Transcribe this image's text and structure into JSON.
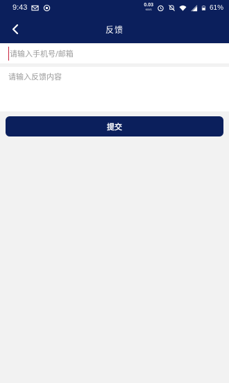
{
  "status_bar": {
    "time": "9:43",
    "speed_value": "0.03",
    "speed_unit": "KB/S",
    "battery": "61%",
    "icons": [
      "mail-icon",
      "hotspot-icon",
      "alarm-icon",
      "mute-icon",
      "wifi-icon",
      "signal-icon",
      "battery-icon"
    ]
  },
  "header": {
    "title": "反馈",
    "back_icon": "back-arrow-icon"
  },
  "form": {
    "contact_placeholder": "请输入手机号/邮箱",
    "contact_value": "",
    "content_placeholder": "请输入反馈内容",
    "content_value": "",
    "submit_label": "提交"
  },
  "colors": {
    "primary": "#0b1f5c",
    "background": "#f2f2f2",
    "cursor": "#c8213a"
  }
}
